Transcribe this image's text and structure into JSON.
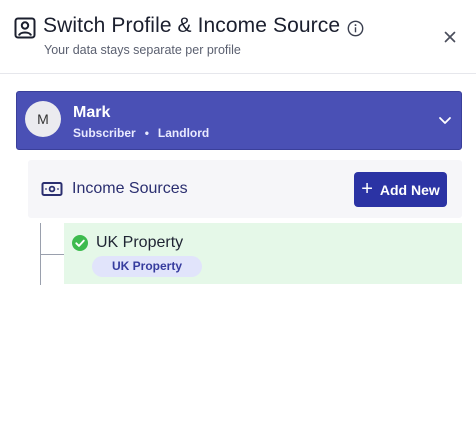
{
  "header": {
    "title": "Switch Profile & Income Source",
    "subtitle": "Your data stays separate per profile",
    "icons": {
      "profile": "profile-badge-icon",
      "info": "info-icon",
      "close": "close-icon"
    }
  },
  "profile": {
    "avatar_initial": "M",
    "name": "Mark",
    "role": "Subscriber",
    "separator": "•",
    "type": "Landlord",
    "expand_icon": "chevron-down-icon",
    "color": "#4a50b5"
  },
  "income_sources": {
    "title": "Income Sources",
    "icon": "cash-icon",
    "add_button": {
      "plus": "+",
      "label": "Add New"
    },
    "items": [
      {
        "name": "UK Property",
        "badge": "UK Property",
        "status": "selected",
        "status_color": "#3dbb4e",
        "bg_color": "#e5f8e8"
      }
    ]
  }
}
